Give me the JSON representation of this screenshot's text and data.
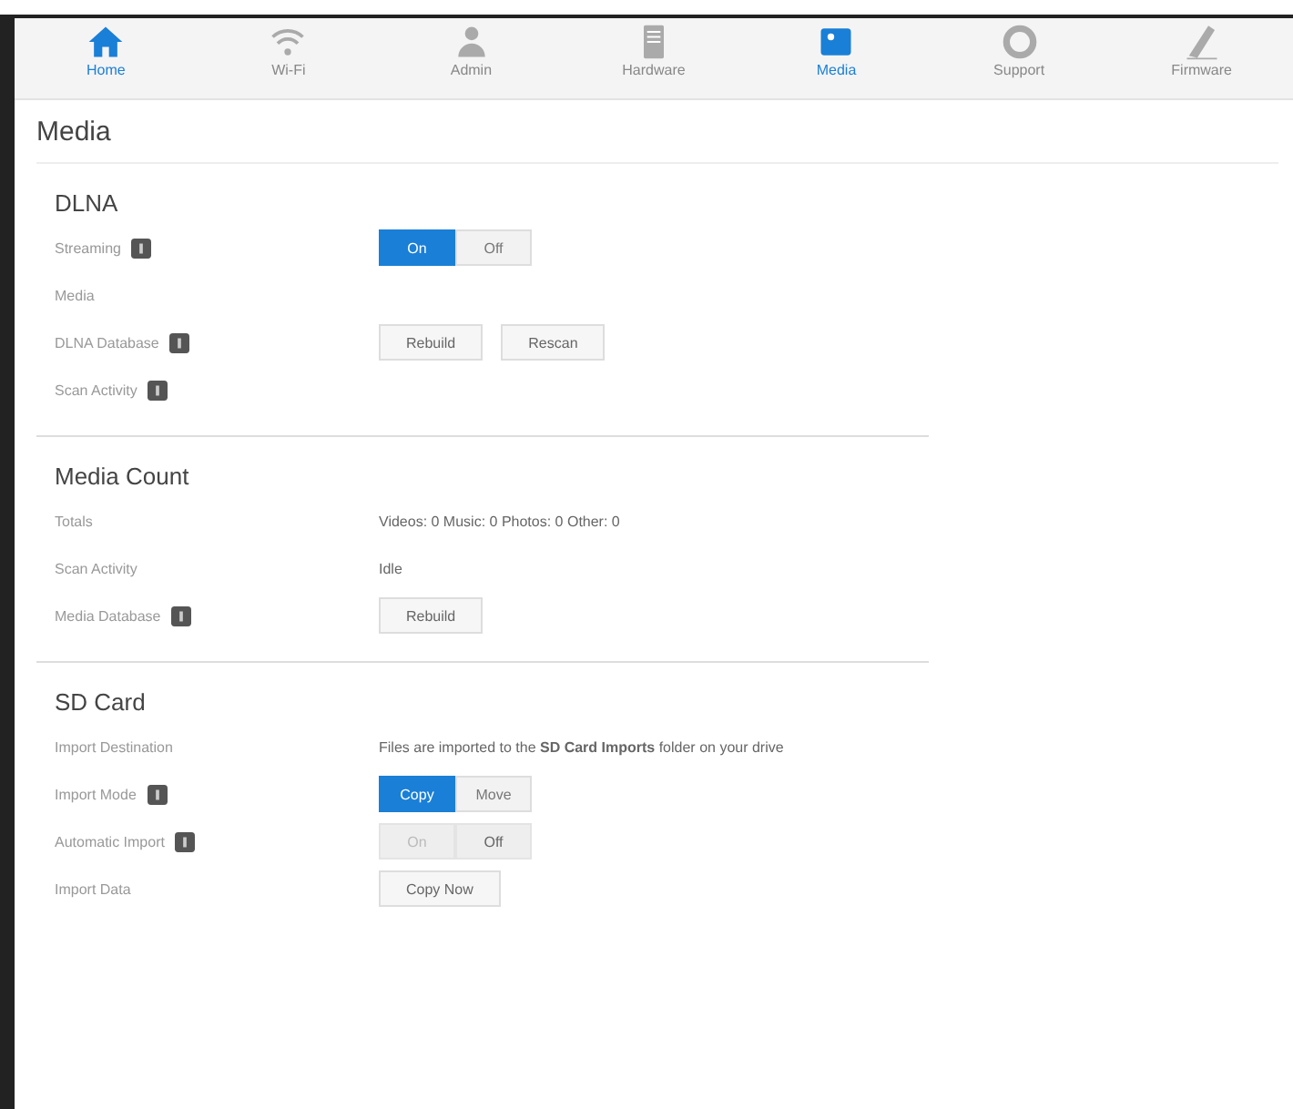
{
  "nav": [
    {
      "label": "Home",
      "selected": true
    },
    {
      "label": "Wi-Fi",
      "selected": false
    },
    {
      "label": "Admin",
      "selected": false
    },
    {
      "label": "Hardware",
      "selected": false
    },
    {
      "label": "Media",
      "selected": true
    },
    {
      "label": "Support",
      "selected": false
    },
    {
      "label": "Firmware",
      "selected": false
    }
  ],
  "page_title": "Media",
  "sections": [
    {
      "title": "DLNA",
      "rows": [
        {
          "label": "Streaming",
          "help": true,
          "kind": "toggle",
          "disabled": false,
          "options": [
            {
              "label": "On",
              "selected": true
            },
            {
              "label": "Off",
              "selected": false
            }
          ]
        },
        {
          "label": "Media",
          "help": false,
          "kind": "none"
        },
        {
          "label": "DLNA Database",
          "help": true,
          "kind": "buttons",
          "buttons": [
            "Rebuild",
            "Rescan"
          ]
        },
        {
          "label": "Scan Activity",
          "help": true,
          "kind": "none"
        }
      ]
    },
    {
      "title": "Media Count",
      "rows": [
        {
          "label": "Totals",
          "help": false,
          "kind": "text",
          "value": "Videos: 0   Music: 0   Photos: 0   Other: 0"
        },
        {
          "label": "Scan Activity",
          "help": false,
          "kind": "text",
          "value": "Idle"
        },
        {
          "label": "Media Database",
          "help": true,
          "kind": "buttons",
          "buttons": [
            "Rebuild"
          ]
        }
      ]
    },
    {
      "title": "SD Card",
      "rows": [
        {
          "label": "Import Destination",
          "help": false,
          "kind": "text",
          "value": "Files are imported to the **SD Card Imports** folder on your drive"
        },
        {
          "label": "Import Mode",
          "help": true,
          "kind": "toggle",
          "disabled": false,
          "options": [
            {
              "label": "Copy",
              "selected": true
            },
            {
              "label": "Move",
              "selected": false
            }
          ]
        },
        {
          "label": "Automatic Import",
          "help": true,
          "kind": "toggle",
          "disabled": true,
          "options": [
            {
              "label": "On",
              "selected": false
            },
            {
              "label": "Off",
              "selected": true
            }
          ]
        },
        {
          "label": "Import Data",
          "help": false,
          "kind": "buttons",
          "buttons": [
            "Copy Now"
          ]
        }
      ]
    }
  ]
}
